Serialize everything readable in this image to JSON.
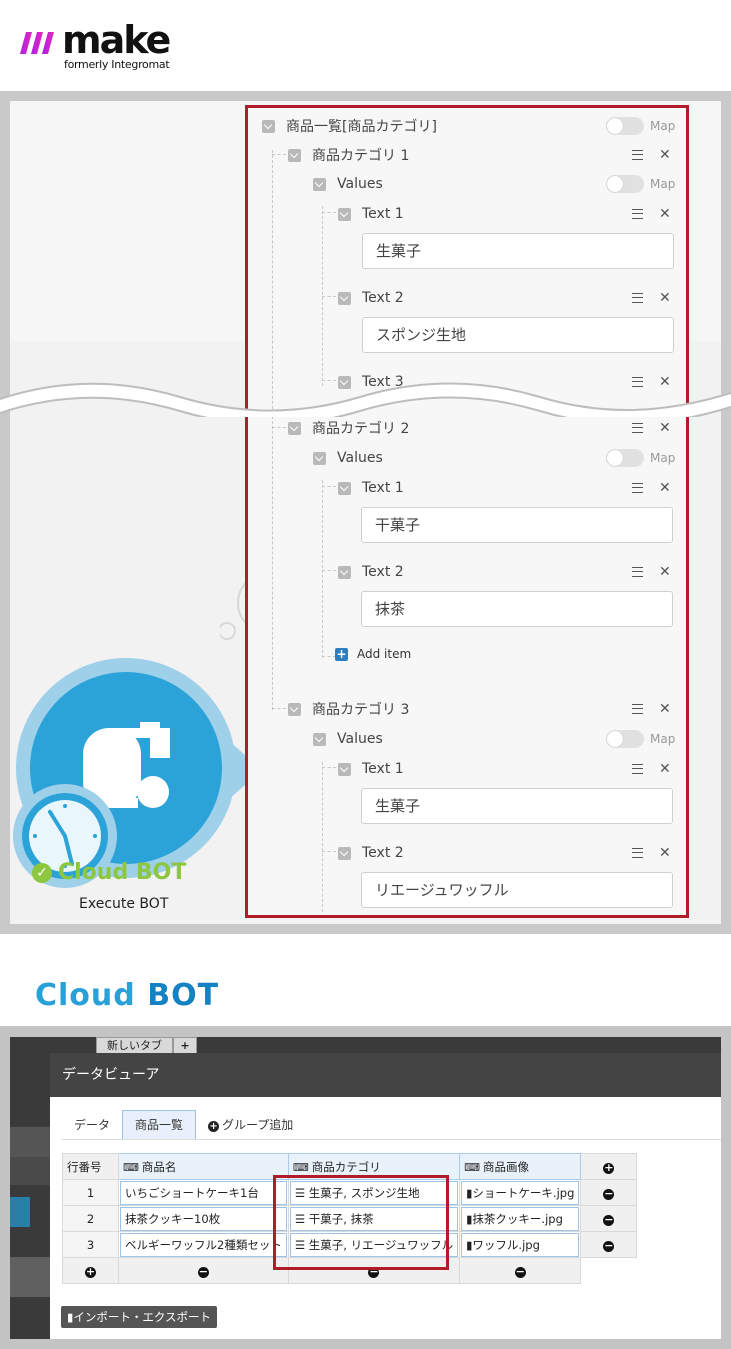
{
  "brand": {
    "name": "make",
    "sub": "formerly Integromat"
  },
  "mapping": {
    "root": {
      "label": "商品一覧[商品カテゴリ]",
      "map_label": "Map"
    },
    "categories": [
      {
        "label": "商品カテゴリ 1",
        "values_label": "Values",
        "items": [
          {
            "label": "Text 1",
            "value": "生菓子"
          },
          {
            "label": "Text 2",
            "value": "スポンジ生地"
          },
          {
            "label": "Text 3"
          }
        ]
      },
      {
        "label": "商品カテゴリ 2",
        "values_label": "Values",
        "items": [
          {
            "label": "Text 1",
            "value": "干菓子"
          },
          {
            "label": "Text 2",
            "value": "抹茶"
          }
        ],
        "add_item": "Add item"
      },
      {
        "label": "商品カテゴリ 3",
        "values_label": "Values",
        "items": [
          {
            "label": "Text 1",
            "value": "生菓子"
          },
          {
            "label": "Text 2",
            "value": "リエージュワッフル"
          }
        ]
      }
    ]
  },
  "module": {
    "name": "Cloud BOT",
    "action": "Execute BOT"
  },
  "section_title": {
    "part1": "Cloud",
    "part2": "BOT"
  },
  "viewer": {
    "browser_tab": "新しいタブ",
    "title": "データビューア",
    "tabs": [
      "データ",
      "商品一覧",
      "グループ追加"
    ],
    "columns": [
      "行番号",
      "商品名",
      "商品カテゴリ",
      "商品画像"
    ],
    "rows": [
      {
        "n": "1",
        "name": "いちごショートケーキ1台",
        "category": "生菓子, スポンジ生地",
        "image": "ショートケーキ.jpg"
      },
      {
        "n": "2",
        "name": "抹茶クッキー10枚",
        "category": "干菓子, 抹茶",
        "image": "抹茶クッキー.jpg"
      },
      {
        "n": "3",
        "name": "ベルギーワッフル2種類セット",
        "category": "生菓子, リエージュワッフル",
        "image": "ワッフル.jpg"
      }
    ],
    "import_export": "インポート・エクスポート"
  },
  "colors": {
    "highlight": "#b21c2a",
    "accent_green": "#8dc63f",
    "accent_blue": "#29a0d8"
  }
}
